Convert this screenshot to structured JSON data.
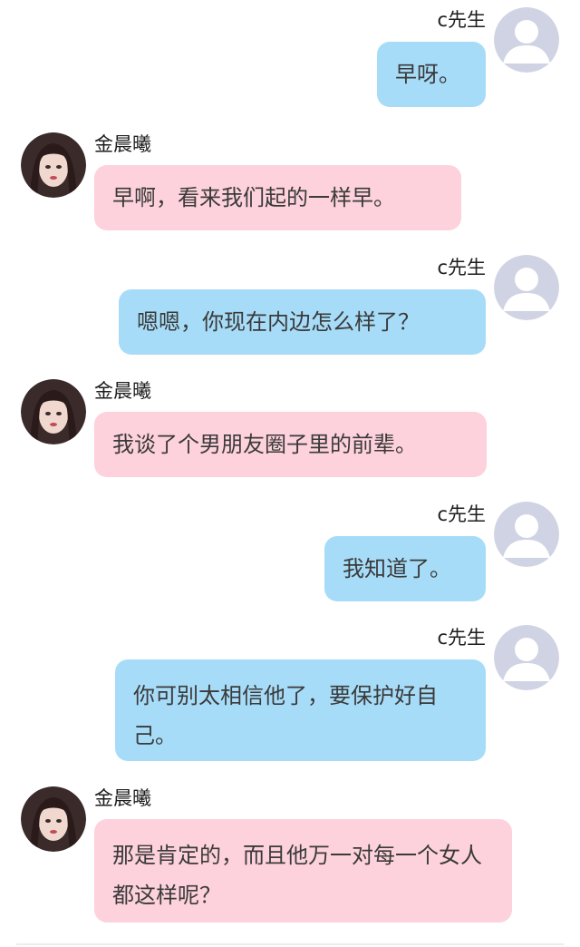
{
  "participants": {
    "me": {
      "name": "c先生",
      "avatar_icon": "default-user-icon"
    },
    "other": {
      "name": "金晨曦",
      "avatar_icon": "profile-photo"
    }
  },
  "messages": [
    {
      "sender": "c先生",
      "text": "早呀。"
    },
    {
      "sender": "金晨曦",
      "text": "早啊，看来我们起的一样早。"
    },
    {
      "sender": "c先生",
      "text": "嗯嗯，你现在内边怎么样了？"
    },
    {
      "sender": "金晨曦",
      "text": "我谈了个男朋友圈子里的前辈。"
    },
    {
      "sender": "c先生",
      "text": "我知道了。"
    },
    {
      "sender": "c先生",
      "text": "你可别太相信他了，要保护好自己。"
    },
    {
      "sender": "金晨曦",
      "text": "那是肯定的，而且他万一对每一个女人都这样呢？"
    }
  ],
  "colors": {
    "my_bubble": "#a7dcf8",
    "their_bubble": "#fdd2dc",
    "default_avatar_bg": "#cfd3e3",
    "default_avatar_fg": "#ffffff"
  }
}
